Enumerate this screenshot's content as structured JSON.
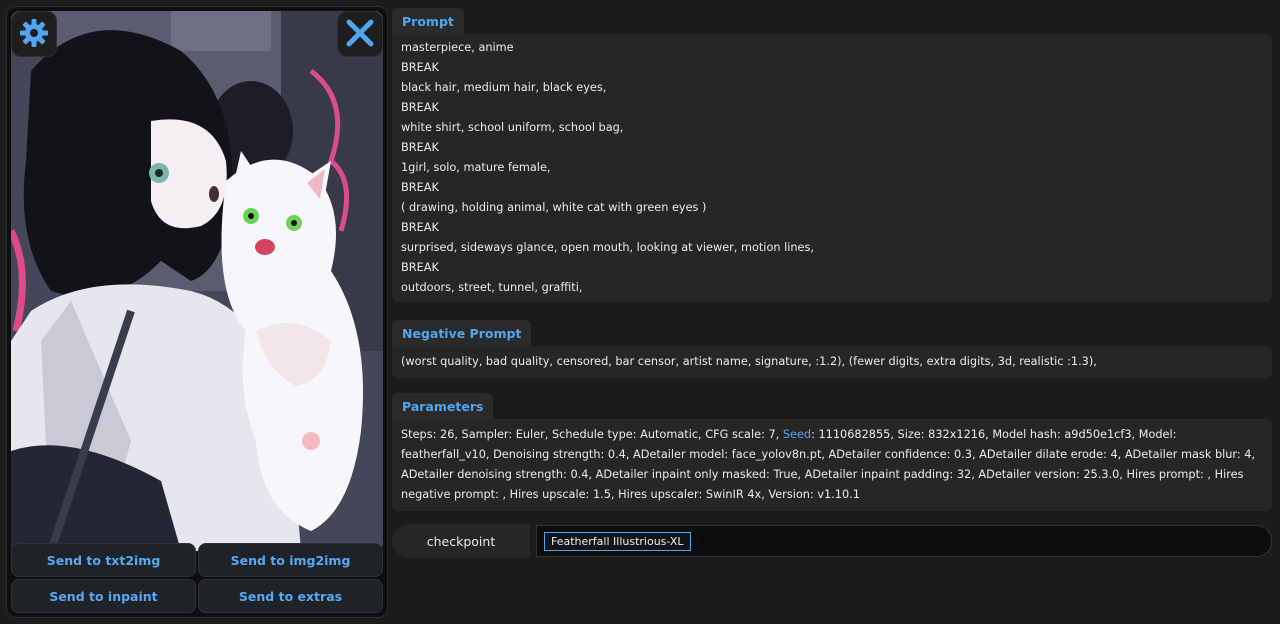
{
  "image_panel": {
    "settings_icon": "gear-icon",
    "close_icon": "close-icon",
    "buttons": [
      "Send to txt2img",
      "Send to img2img",
      "Send to inpaint",
      "Send to extras"
    ]
  },
  "prompt": {
    "label": "Prompt",
    "lines": [
      "masterpiece, anime",
      "BREAK",
      "black hair, medium hair, black eyes,",
      "BREAK",
      "white shirt, school uniform, school bag,",
      "BREAK",
      "1girl, solo, mature female,",
      "BREAK",
      "( drawing, holding animal, white cat with green eyes )",
      "BREAK",
      "surprised, sideways glance, open mouth, looking at viewer, motion lines,",
      "BREAK",
      "outdoors, street, tunnel, graffiti,"
    ]
  },
  "negative_prompt": {
    "label": "Negative Prompt",
    "text": "(worst quality, bad quality, censored, bar censor, artist name, signature, :1.2), (fewer digits, extra digits, 3d, realistic :1.3),"
  },
  "parameters": {
    "label": "Parameters",
    "before_seed": "Steps: 26, Sampler: Euler, Schedule type: Automatic, CFG scale: 7, ",
    "seed_label": "Seed",
    "after_seed": ": 1110682855, Size: 832x1216, Model hash: a9d50e1cf3, Model: featherfall_v10, Denoising strength: 0.4, ADetailer model: face_yolov8n.pt, ADetailer confidence: 0.3, ADetailer dilate erode: 4, ADetailer mask blur: 4, ADetailer denoising strength: 0.4, ADetailer inpaint only masked: True, ADetailer inpaint padding: 32, ADetailer version: 25.3.0, Hires prompt: , Hires negative prompt: , Hires upscale: 1.5, Hires upscaler: SwinIR 4x, Version: v1.10.1"
  },
  "checkpoint": {
    "label": "checkpoint",
    "value": "Featherfall Illustrious-XL"
  },
  "colors": {
    "accent": "#4fa7f2",
    "background": "#1b1b1b",
    "panel": "#262626"
  }
}
